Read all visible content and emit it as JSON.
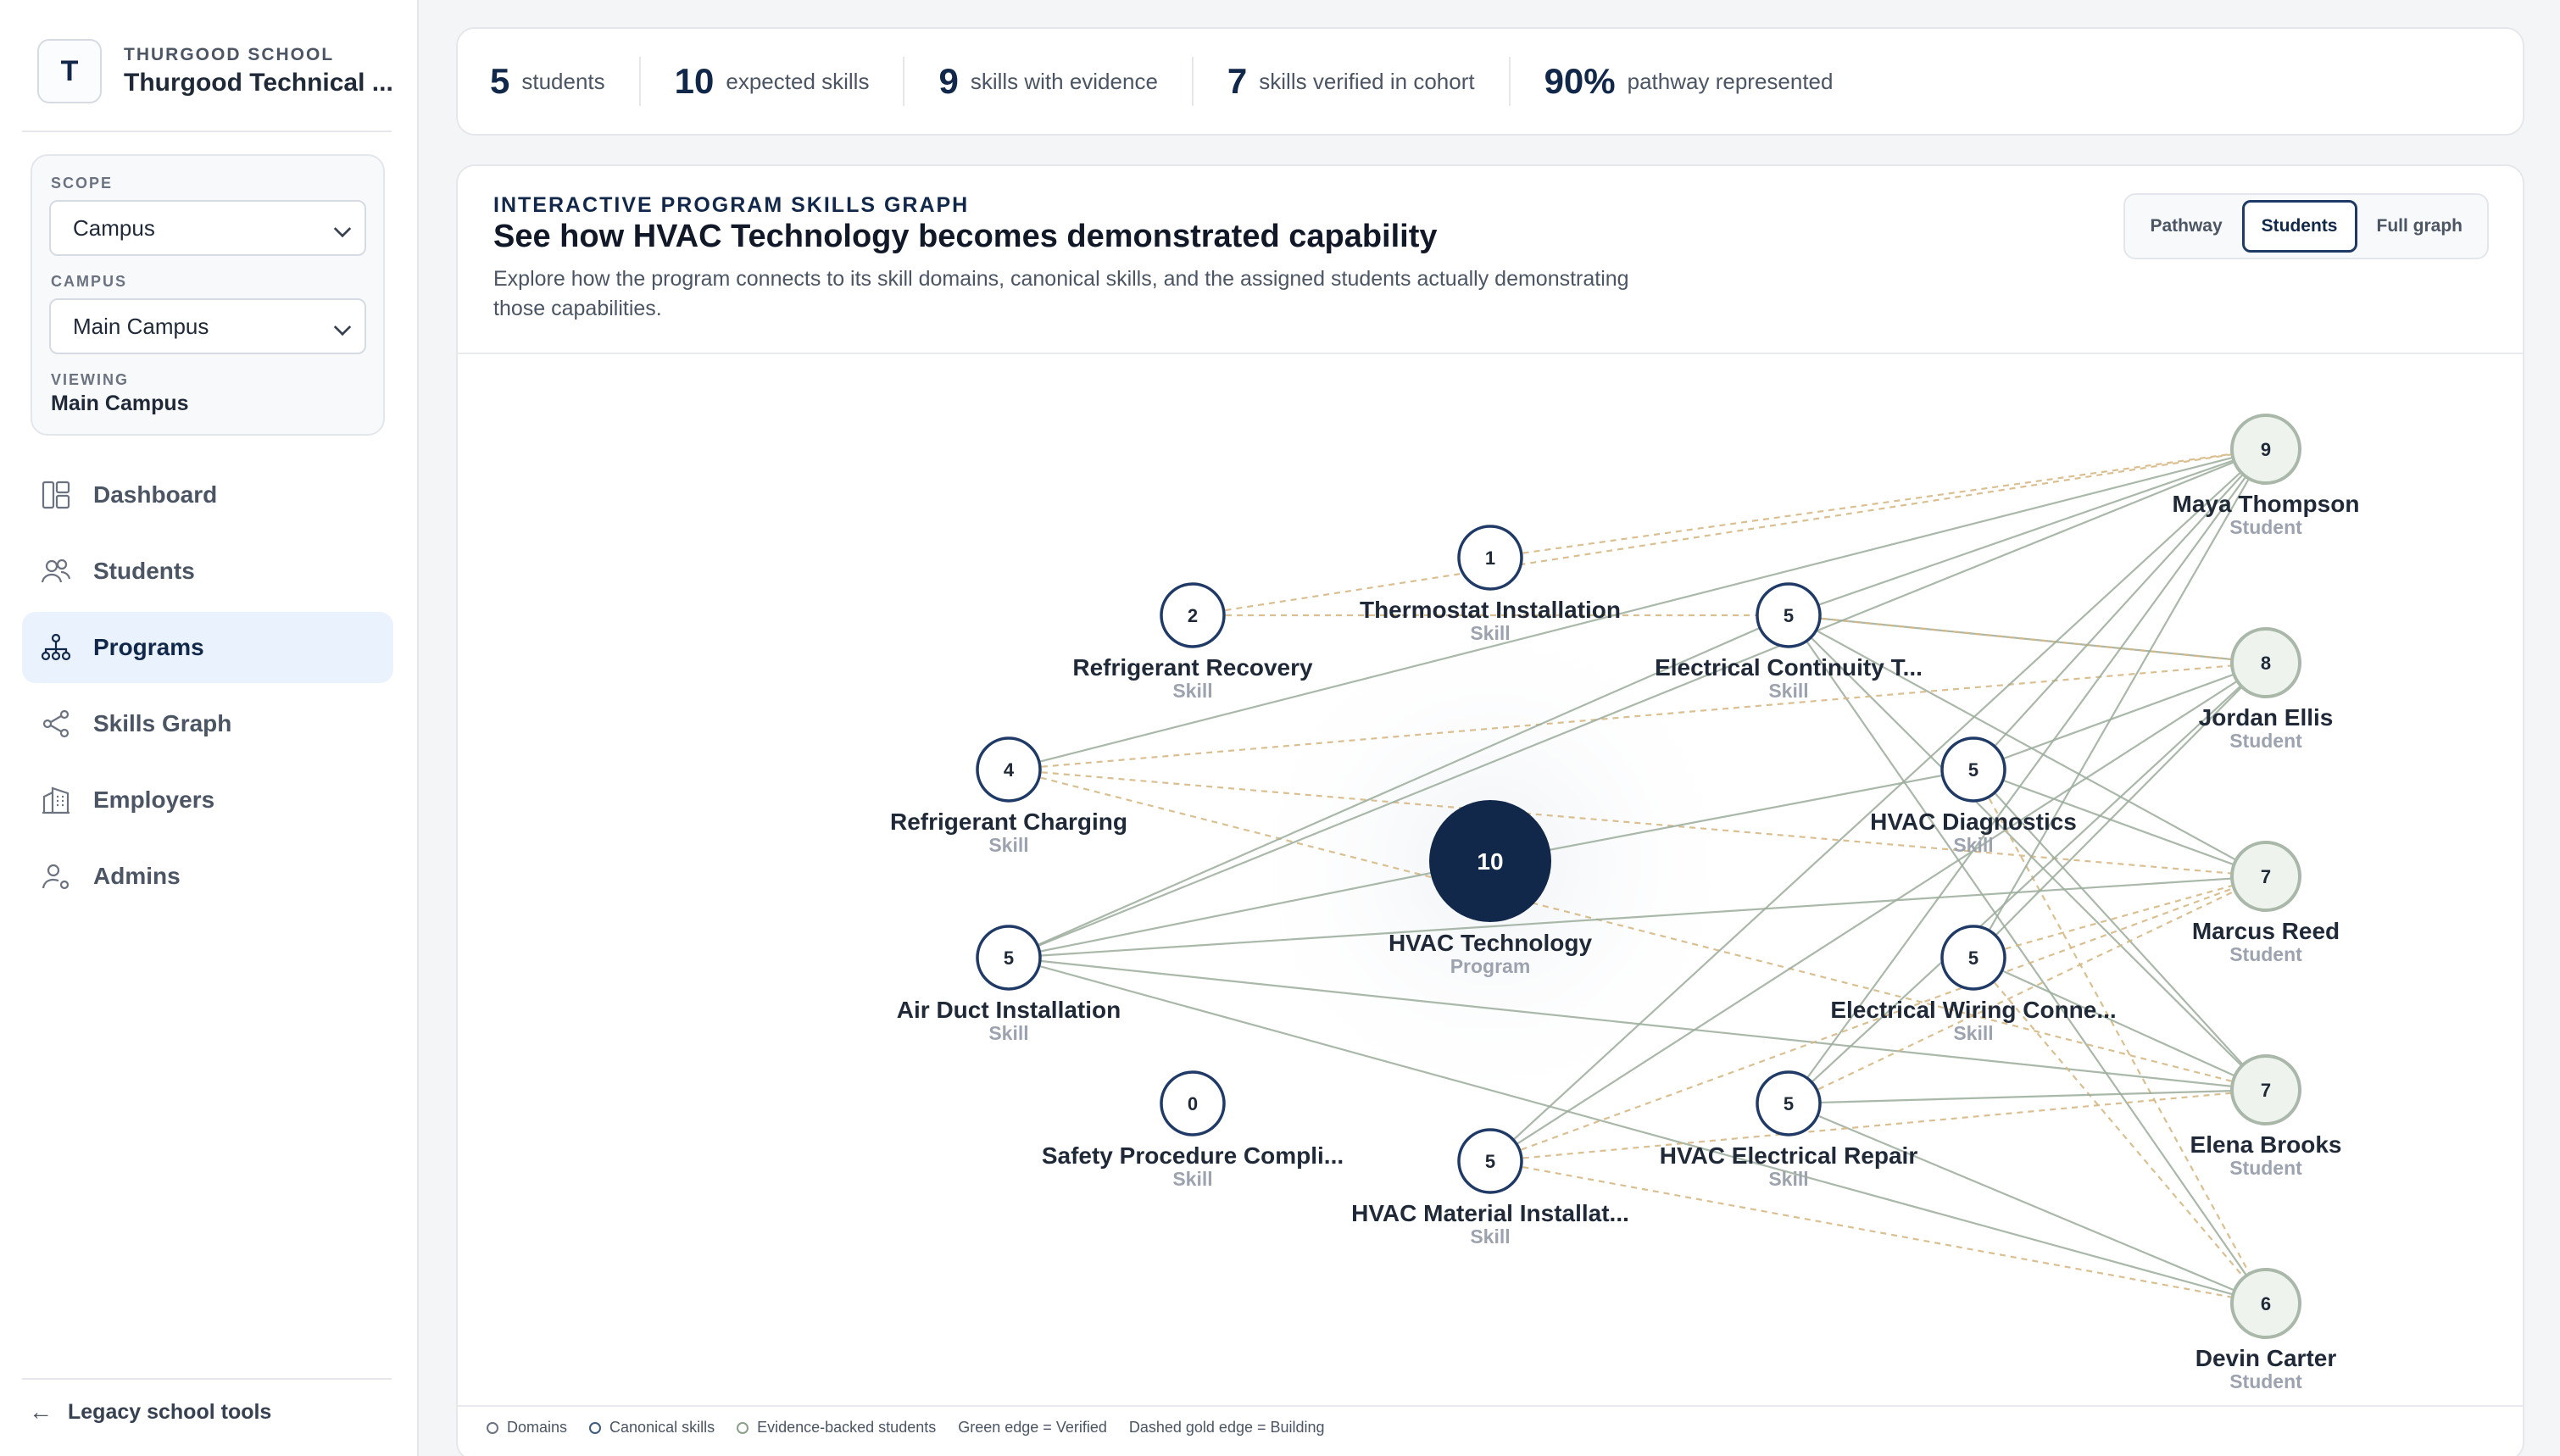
{
  "brand": {
    "initial": "T",
    "kicker": "THURGOOD SCHOOL",
    "name": "Thurgood Technical ..."
  },
  "scope": {
    "scope_label": "SCOPE",
    "scope_value": "Campus",
    "campus_label": "CAMPUS",
    "campus_value": "Main Campus",
    "viewing_label": "VIEWING",
    "viewing_value": "Main Campus"
  },
  "nav": {
    "items": [
      {
        "label": "Dashboard",
        "icon": "dashboard-icon"
      },
      {
        "label": "Students",
        "icon": "users-icon"
      },
      {
        "label": "Programs",
        "icon": "hierarchy-icon",
        "active": true
      },
      {
        "label": "Skills Graph",
        "icon": "share-graph-icon"
      },
      {
        "label": "Employers",
        "icon": "building-icon"
      },
      {
        "label": "Admins",
        "icon": "admin-user-icon"
      }
    ],
    "legacy_label": "Legacy school tools"
  },
  "stats": [
    {
      "value": "5",
      "label": "students"
    },
    {
      "value": "10",
      "label": "expected skills"
    },
    {
      "value": "9",
      "label": "skills with evidence"
    },
    {
      "value": "7",
      "label": "skills verified in cohort"
    },
    {
      "value": "90%",
      "label": "pathway represented"
    }
  ],
  "graph_card": {
    "kicker": "INTERACTIVE PROGRAM SKILLS GRAPH",
    "title": "See how HVAC Technology becomes demonstrated capability",
    "description": "Explore how the program connects to its skill domains, canonical skills, and the assigned students actually demonstrating those capabilities.",
    "views": [
      {
        "label": "Pathway",
        "active": false
      },
      {
        "label": "Students",
        "active": true
      },
      {
        "label": "Full graph",
        "active": false
      }
    ]
  },
  "graph": {
    "program": {
      "id": "program",
      "label": "HVAC Technology",
      "type": "Program",
      "count": "10"
    },
    "skills": [
      {
        "id": "s1",
        "label": "Thermostat Installation",
        "type": "Skill",
        "count": "1"
      },
      {
        "id": "s2",
        "label": "Refrigerant Recovery",
        "type": "Skill",
        "count": "2"
      },
      {
        "id": "s3",
        "label": "Electrical Continuity T...",
        "type": "Skill",
        "count": "5"
      },
      {
        "id": "s4",
        "label": "Refrigerant Charging",
        "type": "Skill",
        "count": "4"
      },
      {
        "id": "s5",
        "label": "HVAC Diagnostics",
        "type": "Skill",
        "count": "5"
      },
      {
        "id": "s6",
        "label": "Air Duct Installation",
        "type": "Skill",
        "count": "5"
      },
      {
        "id": "s7",
        "label": "Electrical Wiring Conne...",
        "type": "Skill",
        "count": "5"
      },
      {
        "id": "s8",
        "label": "Safety Procedure Compli...",
        "type": "Skill",
        "count": "0"
      },
      {
        "id": "s9",
        "label": "HVAC Electrical Repair",
        "type": "Skill",
        "count": "5"
      },
      {
        "id": "s10",
        "label": "HVAC Material Installat...",
        "type": "Skill",
        "count": "5"
      }
    ],
    "students": [
      {
        "id": "st1",
        "label": "Maya Thompson",
        "type": "Student",
        "count": "9"
      },
      {
        "id": "st2",
        "label": "Jordan Ellis",
        "type": "Student",
        "count": "8"
      },
      {
        "id": "st3",
        "label": "Marcus Reed",
        "type": "Student",
        "count": "7"
      },
      {
        "id": "st4",
        "label": "Elena Brooks",
        "type": "Student",
        "count": "7"
      },
      {
        "id": "st5",
        "label": "Devin Carter",
        "type": "Student",
        "count": "6"
      }
    ],
    "edges": [
      {
        "from": "s1",
        "to": "st1",
        "status": "building"
      },
      {
        "from": "s2",
        "to": "st1",
        "status": "building"
      },
      {
        "from": "s2",
        "to": "s3",
        "status": "building"
      },
      {
        "from": "s3",
        "to": "st1",
        "status": "verified"
      },
      {
        "from": "s3",
        "to": "st2",
        "status": "verified"
      },
      {
        "from": "s3",
        "to": "st3",
        "status": "verified"
      },
      {
        "from": "s3",
        "to": "st4",
        "status": "verified"
      },
      {
        "from": "s3",
        "to": "st5",
        "status": "verified"
      },
      {
        "from": "s3",
        "to": "st2",
        "status": "building"
      },
      {
        "from": "s4",
        "to": "st1",
        "status": "verified"
      },
      {
        "from": "s4",
        "to": "st2",
        "status": "building"
      },
      {
        "from": "s4",
        "to": "st3",
        "status": "building"
      },
      {
        "from": "s4",
        "to": "st4",
        "status": "building"
      },
      {
        "from": "s5",
        "to": "st1",
        "status": "verified"
      },
      {
        "from": "s5",
        "to": "st2",
        "status": "verified"
      },
      {
        "from": "s5",
        "to": "st3",
        "status": "verified"
      },
      {
        "from": "s5",
        "to": "st4",
        "status": "verified"
      },
      {
        "from": "s5",
        "to": "st5",
        "status": "building"
      },
      {
        "from": "s6",
        "to": "s3",
        "status": "verified"
      },
      {
        "from": "s6",
        "to": "st1",
        "status": "verified"
      },
      {
        "from": "s6",
        "to": "st3",
        "status": "verified"
      },
      {
        "from": "s6",
        "to": "st4",
        "status": "verified"
      },
      {
        "from": "s6",
        "to": "st5",
        "status": "verified"
      },
      {
        "from": "s7",
        "to": "st1",
        "status": "verified"
      },
      {
        "from": "s7",
        "to": "st2",
        "status": "verified"
      },
      {
        "from": "s7",
        "to": "st3",
        "status": "building"
      },
      {
        "from": "s7",
        "to": "st4",
        "status": "verified"
      },
      {
        "from": "s7",
        "to": "st5",
        "status": "building"
      },
      {
        "from": "s9",
        "to": "st1",
        "status": "verified"
      },
      {
        "from": "s9",
        "to": "st2",
        "status": "verified"
      },
      {
        "from": "s9",
        "to": "st3",
        "status": "building"
      },
      {
        "from": "s9",
        "to": "st4",
        "status": "verified"
      },
      {
        "from": "s9",
        "to": "st5",
        "status": "verified"
      },
      {
        "from": "s10",
        "to": "st1",
        "status": "verified"
      },
      {
        "from": "s10",
        "to": "st2",
        "status": "verified"
      },
      {
        "from": "s10",
        "to": "st3",
        "status": "building"
      },
      {
        "from": "s10",
        "to": "st4",
        "status": "building"
      },
      {
        "from": "s10",
        "to": "st5",
        "status": "building"
      },
      {
        "from": "program",
        "to": "s5",
        "status": "verified"
      },
      {
        "from": "program",
        "to": "s6",
        "status": "verified"
      }
    ]
  },
  "legend": {
    "items": [
      "Domains",
      "Canonical skills",
      "Evidence-backed students",
      "Green edge = Verified",
      "Dashed gold edge = Building"
    ]
  },
  "colors": {
    "accent": "#12284a",
    "verified_edge": "#9aab9a",
    "building_edge": "#d6b885",
    "active_nav_bg": "#eaf2fd"
  }
}
